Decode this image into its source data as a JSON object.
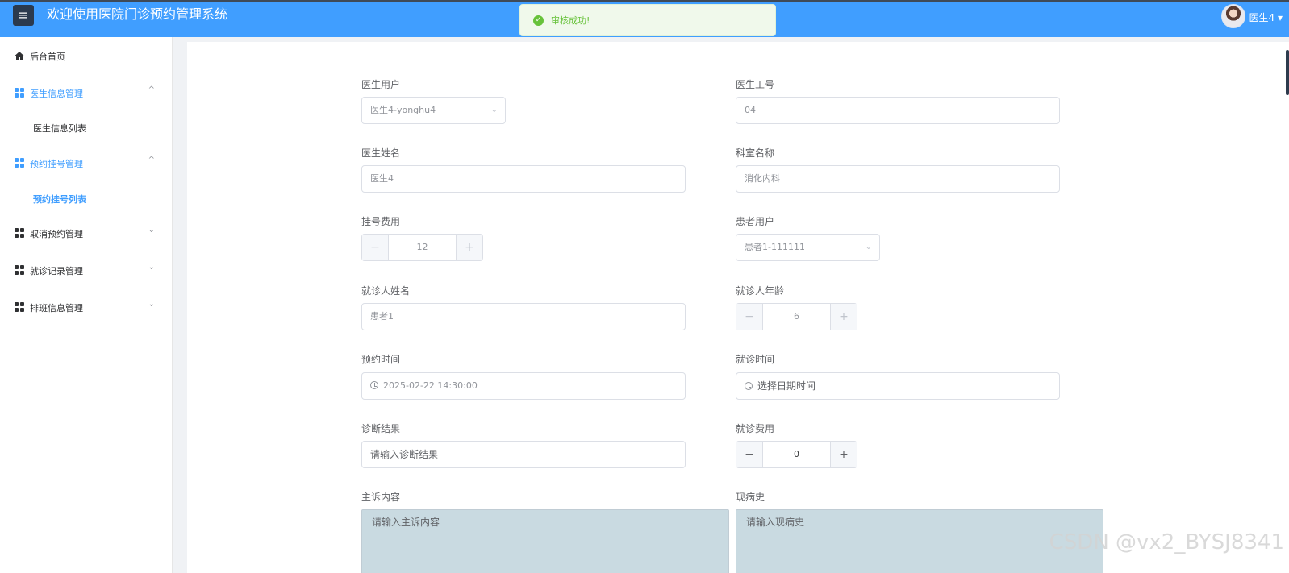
{
  "header": {
    "menu_icon": "hamburger-icon",
    "title": "欢迎使用医院门诊预约管理系统",
    "user": "医生4 ▾"
  },
  "toast": {
    "icon": "check-circle-icon",
    "message": "审核成功!"
  },
  "sidebar": {
    "items": [
      {
        "label": "后台首页",
        "icon": "home-icon"
      },
      {
        "label": "医生信息管理",
        "icon": "grid-icon",
        "chevron": "^"
      },
      {
        "label": "医生信息列表"
      },
      {
        "label": "预约挂号管理",
        "icon": "grid-icon",
        "chevron": "^"
      },
      {
        "label": "预约挂号列表"
      },
      {
        "label": "取消预约管理",
        "icon": "grid-icon",
        "chevron": "⌄"
      },
      {
        "label": "就诊记录管理",
        "icon": "grid-icon",
        "chevron": "⌄"
      },
      {
        "label": "排班信息管理",
        "icon": "grid-icon",
        "chevron": "⌄"
      }
    ]
  },
  "form": {
    "doctor_user": {
      "label": "医生用户",
      "value": "医生4-yonghu4"
    },
    "doctor_id": {
      "label": "医生工号",
      "value": "04"
    },
    "doctor_name": {
      "label": "医生姓名",
      "value": "医生4"
    },
    "department": {
      "label": "科室名称",
      "value": "消化内科"
    },
    "reg_fee": {
      "label": "挂号费用",
      "value": "12"
    },
    "patient_user": {
      "label": "患者用户",
      "value": "患者1-111111"
    },
    "visitor_name": {
      "label": "就诊人姓名",
      "value": "患者1"
    },
    "visitor_age": {
      "label": "就诊人年龄",
      "value": "6"
    },
    "appt_time": {
      "label": "预约时间",
      "value": "2025-02-22 14:30:00"
    },
    "visit_time": {
      "label": "就诊时间",
      "placeholder": "选择日期时间"
    },
    "diagnosis": {
      "label": "诊断结果",
      "placeholder": "请输入诊断结果"
    },
    "visit_fee": {
      "label": "就诊费用",
      "value": "0"
    },
    "complaint": {
      "label": "主诉内容",
      "placeholder": "请输入主诉内容"
    },
    "history": {
      "label": "现病史",
      "placeholder": "请输入现病史"
    }
  },
  "stepper": {
    "minus": "−",
    "plus": "+"
  },
  "watermark": "CSDN @vx2_BYSJ8341",
  "colors": {
    "primary": "#409eff",
    "success": "#67c23a",
    "textarea_bg": "#c9dae1"
  }
}
